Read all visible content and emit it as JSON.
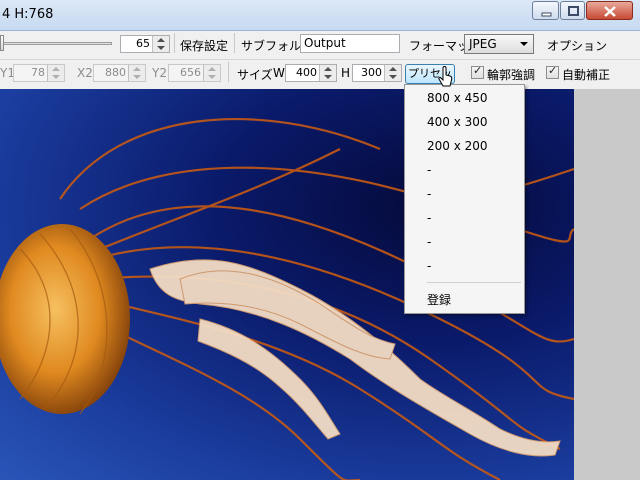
{
  "window": {
    "title": "4 H:768"
  },
  "toolbar1": {
    "slider_value": "65",
    "save_settings_label": "保存設定",
    "subfolder_label": "サブフォルダ",
    "subfolder_value": "Output",
    "format_label": "フォーマット",
    "format_selected": "JPEG",
    "options_label": "オプション"
  },
  "toolbar2": {
    "y1_label": "Y1",
    "y1_value": "78",
    "x2_label": "X2",
    "x2_value": "880",
    "y2_label": "Y2",
    "y2_value": "656",
    "size_label": "サイズ",
    "w_label": "W",
    "w_value": "400",
    "h_label": "H",
    "h_value": "300",
    "preset_button_label": "プリセット",
    "edge_enhance_label": "輪郭強調",
    "edge_enhance_checked": true,
    "auto_correct_label": "自動補正",
    "auto_correct_checked": true
  },
  "preset_menu": {
    "items": [
      "800 x 450",
      "400 x 300",
      "200 x 200",
      "-",
      "-",
      "-",
      "-",
      "-"
    ],
    "register_label": "登録"
  },
  "icons": {
    "minimize": "minimize-icon",
    "maximize": "maximize-icon",
    "close": "close-icon",
    "cursor": "mouse-pointer-icon"
  },
  "colors": {
    "close_button": "#c74a34",
    "background_deep": "#050a3a",
    "jellyfish": "#e8902a"
  }
}
